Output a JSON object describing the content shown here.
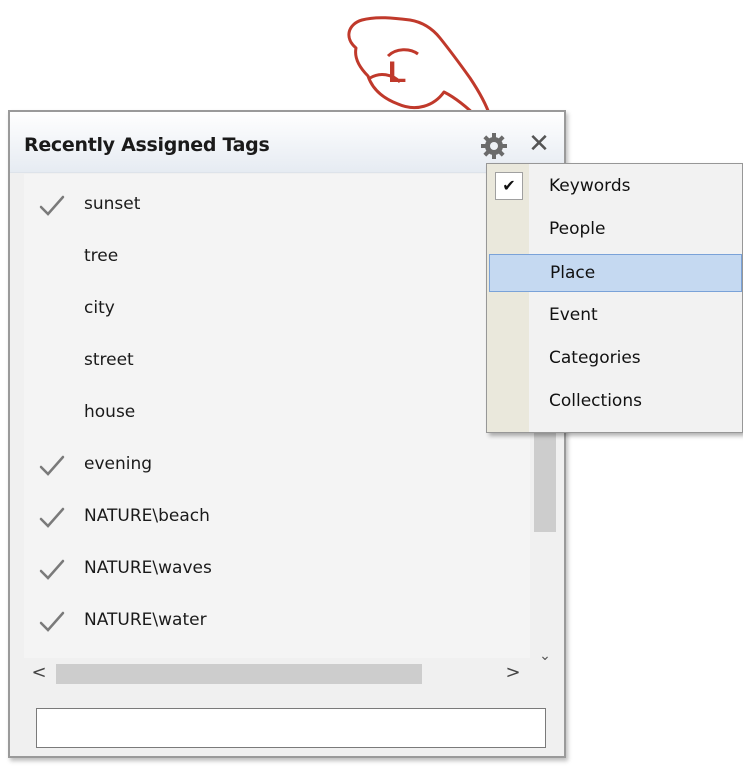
{
  "pointer": {
    "key_label": "L"
  },
  "panel": {
    "title": "Recently Assigned Tags",
    "close_glyph": "✕",
    "gear_icon": "gear-icon"
  },
  "tags": [
    {
      "label": "sunset",
      "checked": true
    },
    {
      "label": "tree",
      "checked": false
    },
    {
      "label": "city",
      "checked": false
    },
    {
      "label": "street",
      "checked": false
    },
    {
      "label": "house",
      "checked": false
    },
    {
      "label": "evening",
      "checked": true
    },
    {
      "label": "NATURE\\beach",
      "checked": true
    },
    {
      "label": "NATURE\\waves",
      "checked": true
    },
    {
      "label": "NATURE\\water",
      "checked": true
    }
  ],
  "scroll": {
    "down_glyph": "⌄",
    "left_glyph": "<",
    "right_glyph": ">"
  },
  "tag_input": {
    "value": ""
  },
  "menu": {
    "check_glyph": "✔",
    "items": [
      {
        "label": "Keywords",
        "checked": true,
        "highlighted": false
      },
      {
        "label": "People",
        "checked": false,
        "highlighted": false
      },
      {
        "label": "Place",
        "checked": false,
        "highlighted": true
      },
      {
        "label": "Event",
        "checked": false,
        "highlighted": false
      },
      {
        "label": "Categories",
        "checked": false,
        "highlighted": false
      },
      {
        "label": "Collections",
        "checked": false,
        "highlighted": false
      }
    ]
  },
  "colors": {
    "highlight": "#c5d9f1",
    "check": "#7a7a7a",
    "pointer": "#c0392b"
  }
}
